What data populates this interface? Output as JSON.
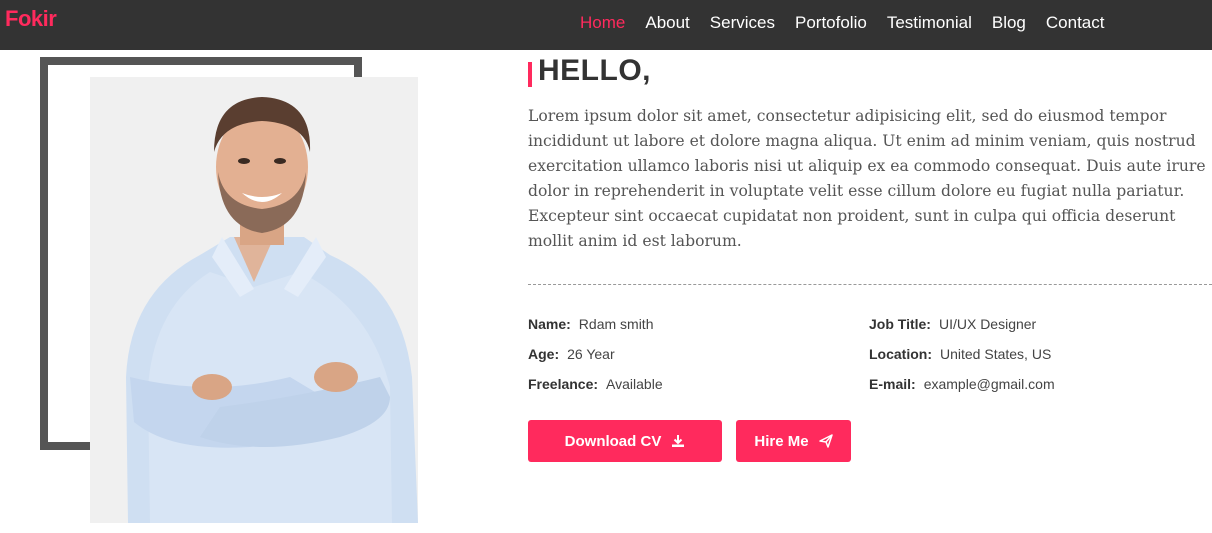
{
  "nav": {
    "brand": "Fokir",
    "items": [
      "Home",
      "About",
      "Services",
      "Portofolio",
      "Testimonial",
      "Blog",
      "Contact"
    ],
    "active": "Home"
  },
  "about": {
    "heading": "HELLO,",
    "paragraph": "Lorem ipsum dolor sit amet, consectetur adipisicing elit, sed do eiusmod tempor incididunt ut labore et dolore magna aliqua. Ut enim ad minim veniam, quis nostrud exercitation ullamco laboris nisi ut aliquip ex ea commodo consequat. Duis aute irure dolor in reprehenderit in voluptate velit esse cillum dolore eu fugiat nulla pariatur. Excepteur sint occaecat cupidatat non proident, sunt in culpa qui officia deserunt mollit anim id est laborum.",
    "info": {
      "name_label": "Name:",
      "name_value": "Rdam smith",
      "age_label": "Age:",
      "age_value": "26 Year",
      "freelance_label": "Freelance:",
      "freelance_value": "Available",
      "job_label": "Job Title:",
      "job_value": "UI/UX Designer",
      "location_label": "Location:",
      "location_value": "United States, US",
      "email_label": "E-mail:",
      "email_value": "example@gmail.com"
    },
    "buttons": {
      "download": "Download CV",
      "hire": "Hire Me"
    }
  },
  "colors": {
    "accent": "#ff2a5d",
    "navbar": "#333333",
    "frame": "#555555"
  },
  "icons": {
    "download": "download-icon",
    "hire": "paper-plane-icon",
    "photo": "man-portrait-photo"
  }
}
